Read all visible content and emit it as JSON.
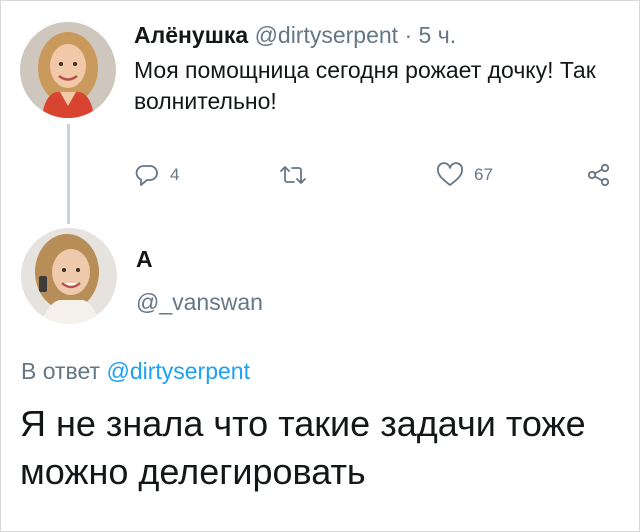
{
  "tweet": {
    "author_name": "Алёнушка",
    "handle": "@dirtyserpent",
    "separator": "·",
    "time": "5 ч.",
    "text": "Моя помощница сегодня рожает дочку! Так волнительно!",
    "actions": {
      "reply_count": "4",
      "like_count": "67"
    }
  },
  "reply": {
    "author_name": "А",
    "handle": "@_vanswan",
    "reply_to_prefix": "В ответ",
    "reply_to_handle": "@dirtyserpent",
    "text": "Я не знала что такие задачи тоже можно делегировать"
  },
  "colors": {
    "secondary_text": "#657786",
    "link": "#1da1f2",
    "thread_line": "#c9d3dc"
  },
  "icons": [
    "reply-icon",
    "retweet-icon",
    "like-icon",
    "share-icon"
  ]
}
